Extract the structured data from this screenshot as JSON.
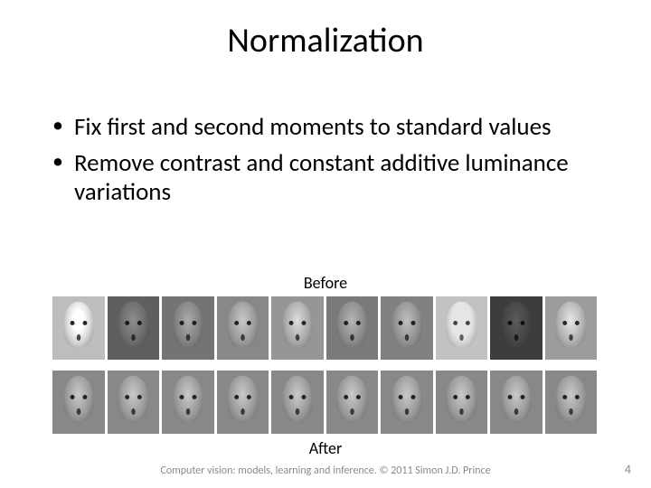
{
  "title": "Normalization",
  "bullets": [
    "Fix first and second moments to standard values",
    "Remove contrast and constant additive luminance variations"
  ],
  "labels": {
    "before": "Before",
    "after": "After"
  },
  "image_grid": {
    "columns": 10,
    "rows_shown": [
      "before",
      "after"
    ]
  },
  "footer": "Computer vision: models, learning and inference.  © 2011 Simon J.D. Prince",
  "page_number": "4"
}
